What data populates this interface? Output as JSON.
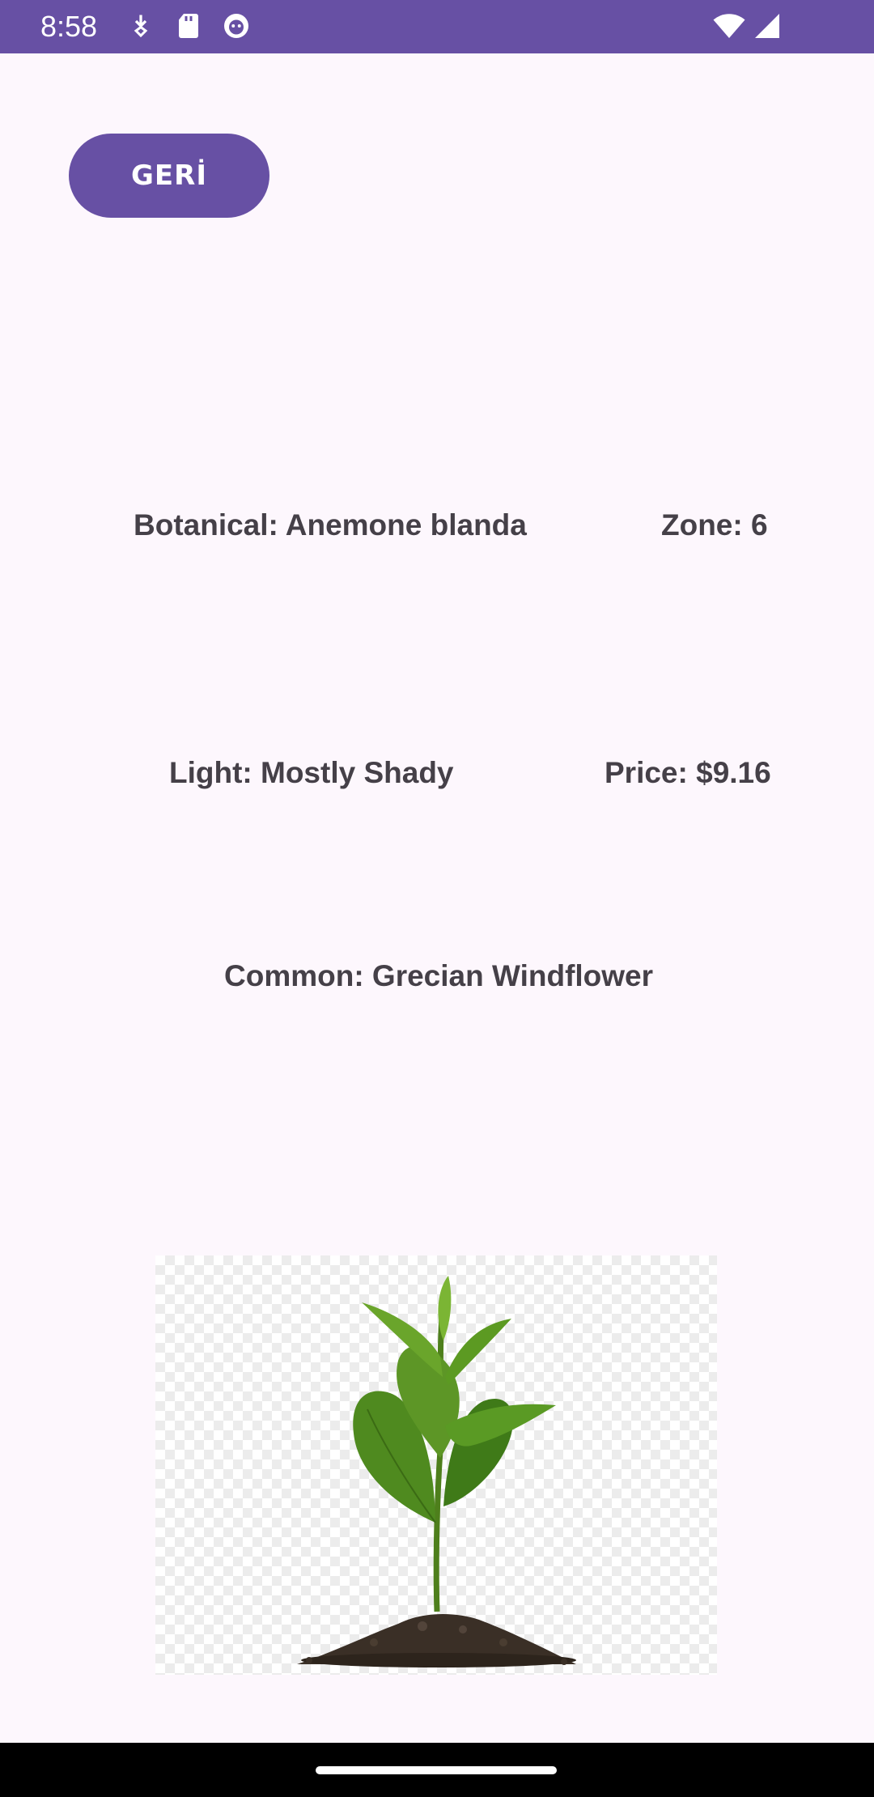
{
  "status_bar": {
    "time": "8:58",
    "icons": [
      "download-icon",
      "sd-card-icon",
      "face-icon",
      "wifi-icon",
      "signal-icon"
    ],
    "background": "#6750a4"
  },
  "back_button": {
    "label": "GERİ",
    "color": "#6750a4"
  },
  "plant": {
    "botanical": "Botanical: Anemone blanda",
    "zone": "Zone: 6",
    "light": "Light: Mostly Shady",
    "price": "Price: $9.16",
    "common": "Common: Grecian Windflower"
  },
  "image": {
    "subject": "plant-seedling-image"
  }
}
